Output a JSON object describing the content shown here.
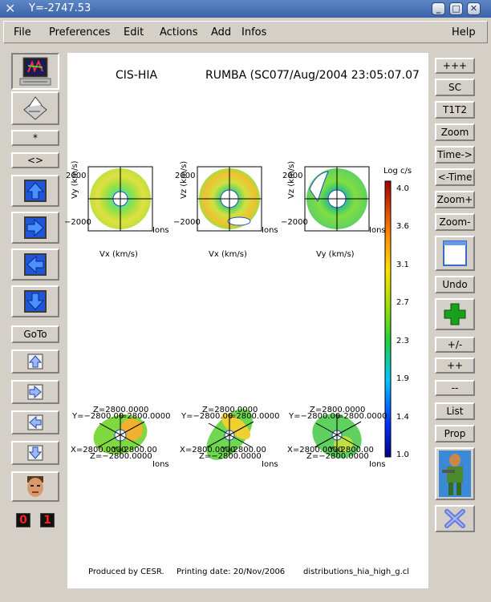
{
  "window": {
    "title": "Y=-2747.53",
    "controls": [
      "_",
      "□",
      "✕"
    ]
  },
  "menu": {
    "items": [
      "File",
      "Preferences",
      "Edit",
      "Actions",
      "Add",
      "Infos"
    ],
    "help": "Help"
  },
  "left_toolbar": {
    "star": "*",
    "diamond": "<>",
    "goto": "GoTo",
    "digit0": "0",
    "digit1": "1"
  },
  "right_toolbar": {
    "buttons": [
      "+++",
      "SC",
      "T1T2",
      "Zoom",
      "Time->",
      "<-Time",
      "Zoom+",
      "Zoom-"
    ],
    "undo": "Undo",
    "lower": [
      "+/-",
      "++",
      "--",
      "List",
      "Prop"
    ]
  },
  "plot": {
    "instrument": "CIS-HIA",
    "mode": "RUMBA (SC07",
    "datetime": "7/Aug/2004 23:05:07.07",
    "colorbar": {
      "label": "Log c/s",
      "ticks": [
        "4.0",
        "3.6",
        "3.1",
        "2.7",
        "2.3",
        "1.9",
        "1.4",
        "1.0"
      ],
      "range": [
        1.0,
        4.0
      ]
    },
    "top_panels": [
      {
        "ylabel": "Vy (km/s)",
        "xlabel": "Vx (km/s)",
        "ymax": "2000",
        "ymin": "−2000",
        "species": "Ions"
      },
      {
        "ylabel": "Vz (km/s)",
        "xlabel": "Vx (km/s)",
        "ymax": "2000",
        "ymin": "−2000",
        "species": "Ions"
      },
      {
        "ylabel": "Vz (km/s)",
        "xlabel": "Vy (km/s)",
        "ymax": "2000",
        "ymin": "−2000",
        "species": "Ions"
      }
    ],
    "bottom_panels": [
      {
        "ztop": "Z=2800.0000",
        "ymid": "Y=−2800.00",
        "yright": "=2800.0000",
        "xlow": "X=2800.0000",
        "xlow2": "Y=2800.00",
        "zbot": "Z=−2800.0000",
        "species": "Ions"
      },
      {
        "ztop": "Z=2800.0000",
        "ymid": "Y=−2800.00",
        "yright": "=2800.0000",
        "xlow": "X=2800.0000",
        "xlow2": "Y=2800.00",
        "zbot": "Z=−2800.0000",
        "species": "Ions"
      },
      {
        "ztop": "Z=2800.0000",
        "ymid": "Y=−2800.00",
        "yright": "=2800.0000",
        "xlow": "X=2800.0000",
        "xlow2": "Y=2800.00",
        "zbot": "Z=−2800.0000",
        "species": "Ions"
      }
    ],
    "footer": {
      "producer": "Produced by CESR.",
      "print_date": "Printing date: 20/Nov/2006",
      "file": "distributions_hia_high_g.cl"
    }
  }
}
